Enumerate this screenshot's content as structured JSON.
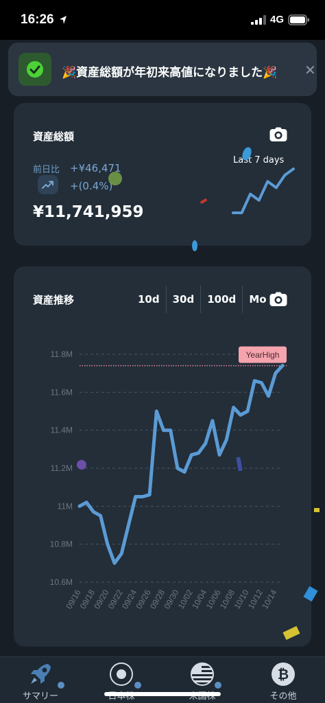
{
  "status": {
    "time": "16:26",
    "network": "4G"
  },
  "toast": {
    "message": "🎉資産総額が年初来高値になりました🎉",
    "close": "✕"
  },
  "summary": {
    "title": "資産総額",
    "prev_day_label": "前日比",
    "change_amount": "+¥46,471",
    "change_percent": "+(0.4%)",
    "total": "¥11,741,959",
    "sparkline_label": "Last 7 days",
    "sparkline_values": [
      0,
      0,
      3,
      2,
      5,
      4,
      6,
      7
    ]
  },
  "history": {
    "title": "資産推移",
    "ranges": [
      "10d",
      "30d",
      "100d",
      "Mo"
    ],
    "year_high_label": "YearHigh"
  },
  "chart_data": {
    "type": "line",
    "x": [
      "09/16",
      "09/17",
      "09/18",
      "09/19",
      "09/20",
      "09/21",
      "09/22",
      "09/23",
      "09/24",
      "09/25",
      "09/26",
      "09/27",
      "09/28",
      "09/29",
      "09/30",
      "10/01",
      "10/02",
      "10/03",
      "10/04",
      "10/05",
      "10/06",
      "10/07",
      "10/08",
      "10/09",
      "10/10",
      "10/11",
      "10/12",
      "10/13",
      "10/14",
      "10/15"
    ],
    "x_tick_labels": [
      "09/16",
      "09/18",
      "09/20",
      "09/22",
      "09/24",
      "09/26",
      "09/28",
      "09/30",
      "10/02",
      "10/04",
      "10/06",
      "10/08",
      "10/10",
      "10/12",
      "10/14"
    ],
    "series": [
      {
        "values": [
          11.0,
          11.02,
          10.97,
          10.95,
          10.8,
          10.7,
          10.75,
          10.9,
          11.05,
          11.05,
          11.06,
          11.5,
          11.4,
          11.4,
          11.2,
          11.18,
          11.27,
          11.28,
          11.33,
          11.45,
          11.27,
          11.35,
          11.52,
          11.48,
          11.5,
          11.66,
          11.65,
          11.58,
          11.7,
          11.74
        ]
      }
    ],
    "yticks": [
      "10.6M",
      "10.8M",
      "11M",
      "11.2M",
      "11.4M",
      "11.6M",
      "11.8M"
    ],
    "ylim": [
      10.6,
      11.8
    ],
    "reference_line": {
      "label": "YearHigh",
      "value": 11.74
    },
    "color": "#5b9bd5",
    "reference_color": "#e88a9a",
    "grid": true
  },
  "tabbar": {
    "items": [
      {
        "label": "サマリー",
        "icon": "rocket-icon"
      },
      {
        "label": "日本株",
        "icon": "japan-flag-icon"
      },
      {
        "label": "米国株",
        "icon": "us-flag-icon"
      },
      {
        "label": "その他",
        "icon": "bitcoin-icon"
      }
    ]
  }
}
